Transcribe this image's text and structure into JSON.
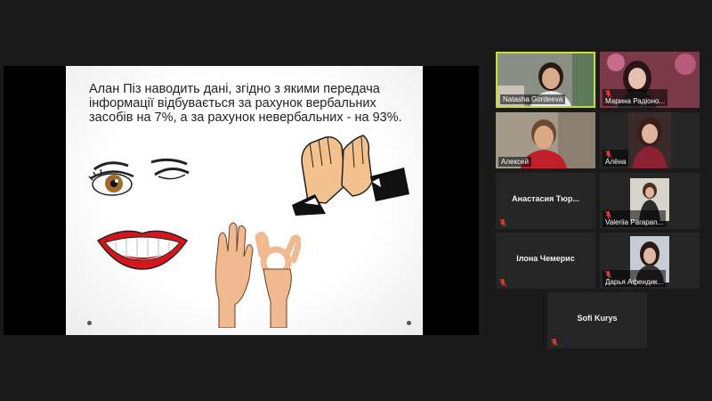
{
  "slide": {
    "lines": [
      "Алан Піз наводить дані, згідно з якими передача",
      "інформації відбувається за рахунок вербальних",
      "засобів на 7%, а за рахунок невербальних - на 93%."
    ]
  },
  "participants": [
    {
      "name": "Natasha Gordeeva",
      "video": true,
      "active": true,
      "muted": false
    },
    {
      "name": "Марина Радіоно...",
      "video": true,
      "active": false,
      "muted": true
    },
    {
      "name": "Алексей",
      "video": true,
      "active": false,
      "muted": false
    },
    {
      "name": "Алёна",
      "video": true,
      "active": false,
      "muted": true
    },
    {
      "name": "Анастасия Тюр...",
      "video": false,
      "active": false,
      "muted": true
    },
    {
      "name": "Valeriia Parapan...",
      "video": true,
      "active": false,
      "muted": true
    },
    {
      "name": "Ілона Чемерис",
      "video": false,
      "active": false,
      "muted": true
    },
    {
      "name": "Дарья Афендик...",
      "video": true,
      "active": false,
      "muted": true
    },
    {
      "name": "Sofi Kurys",
      "video": false,
      "active": false,
      "muted": true
    }
  ],
  "colors": {
    "background": "#1a1a1a",
    "active_speaker_border": "#c8e02a",
    "muted_mic": "#e23b3b",
    "lips": "#d6161c"
  }
}
